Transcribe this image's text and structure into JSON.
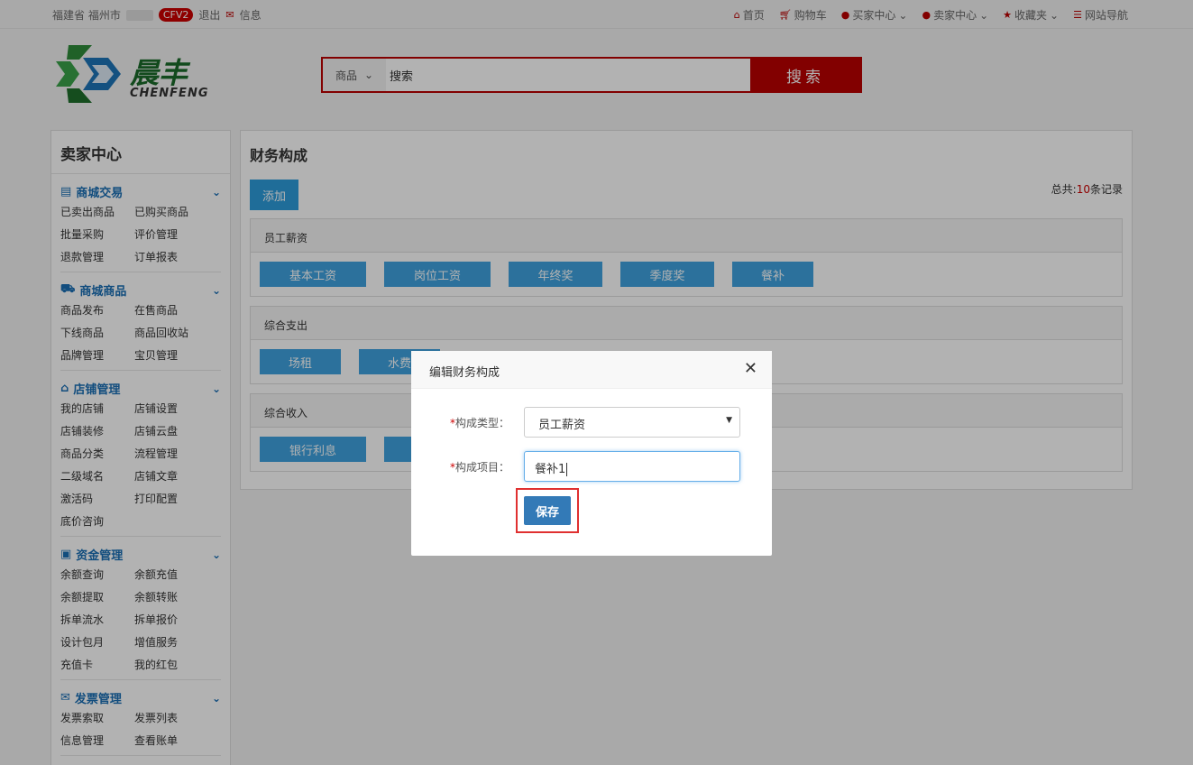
{
  "topbar": {
    "location": "福建省 福州市",
    "badge": "CFV2",
    "logout": "退出",
    "message": "信息",
    "nav": [
      {
        "icon": "home-icon",
        "label": "首页"
      },
      {
        "icon": "cart-icon",
        "label": "购物车"
      },
      {
        "icon": "user-icon",
        "label": "买家中心"
      },
      {
        "icon": "user-icon",
        "label": "卖家中心"
      },
      {
        "icon": "star-icon",
        "label": "收藏夹"
      },
      {
        "icon": "list-icon",
        "label": "网站导航"
      }
    ]
  },
  "logo": {
    "cn": "晨丰",
    "en": "CHENFENG"
  },
  "search": {
    "category": "商品",
    "value": "搜索",
    "button": "搜索"
  },
  "sidebar": {
    "title": "卖家中心",
    "groups": [
      {
        "icon": "list-icon",
        "title": "商城交易",
        "links": [
          "已卖出商品",
          "已购买商品",
          "批量采购",
          "评价管理",
          "退款管理",
          "订单报表"
        ]
      },
      {
        "icon": "truck-icon",
        "title": "商城商品",
        "links": [
          "商品发布",
          "在售商品",
          "下线商品",
          "商品回收站",
          "品牌管理",
          "宝贝管理"
        ]
      },
      {
        "icon": "home-icon",
        "title": "店铺管理",
        "links": [
          "我的店铺",
          "店铺设置",
          "店铺装修",
          "店铺云盘",
          "商品分类",
          "流程管理",
          "二级域名",
          "店铺文章",
          "激活码",
          "打印配置",
          "底价咨询"
        ]
      },
      {
        "icon": "money-icon",
        "title": "资金管理",
        "links": [
          "余额查询",
          "余额充值",
          "余额提取",
          "余额转账",
          "拆单流水",
          "拆单报价",
          "设计包月",
          "增值服务",
          "充值卡",
          "我的红包"
        ]
      },
      {
        "icon": "envelope-icon",
        "title": "发票管理",
        "links": [
          "发票索取",
          "发票列表",
          "信息管理",
          "查看账单"
        ]
      }
    ]
  },
  "main": {
    "title": "财务构成",
    "add_label": "添加",
    "total_prefix": "总共:",
    "total_count": "10",
    "total_suffix": "条记录",
    "sections": [
      {
        "title": "员工薪资",
        "items": [
          "基本工资",
          "岗位工资",
          "年终奖",
          "季度奖",
          "餐补"
        ]
      },
      {
        "title": "综合支出",
        "items": [
          "场租",
          "水费"
        ]
      },
      {
        "title": "综合收入",
        "items": [
          "银行利息",
          ""
        ]
      }
    ]
  },
  "modal": {
    "title": "编辑财务构成",
    "type_label": "构成类型：",
    "type_value": "员工薪资",
    "item_label": "构成项目：",
    "item_value": "餐补1",
    "save_label": "保存"
  },
  "colors": {
    "brand_red": "#b00000",
    "accent_blue": "#3fa3e0",
    "save_blue": "#337ab7",
    "highlight": "#e03030"
  }
}
